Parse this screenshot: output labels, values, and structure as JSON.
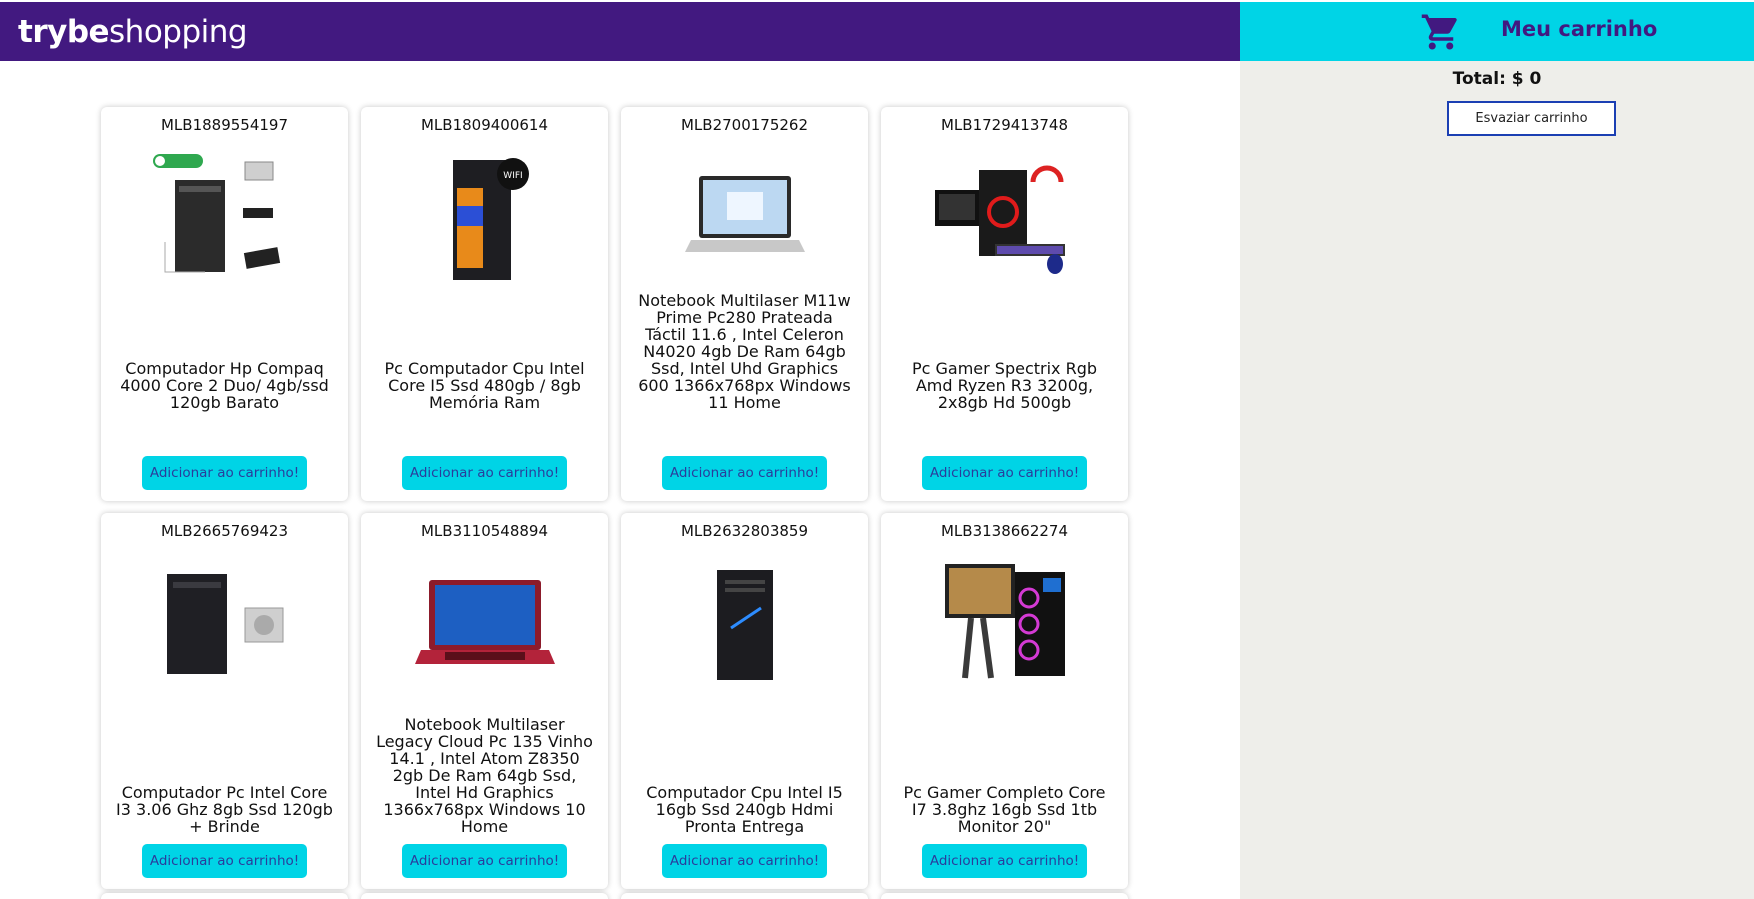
{
  "brand": {
    "bold": "trybe",
    "light": "shopping"
  },
  "cart": {
    "icon": "shopping-cart-icon",
    "title": "Meu carrinho",
    "total": "Total: $ 0",
    "empty_label": "Esvaziar carrinho"
  },
  "colors": {
    "header": "#421980",
    "accent": "#00d4e6",
    "panel": "#eeeeea",
    "button_border": "#1b3fb3"
  },
  "products": [
    {
      "id": "MLB1889554197",
      "title": "Computador Hp Compaq 4000 Core 2 Duo/ 4gb/ssd 120gb Barato",
      "button": "Adicionar ao carrinho!",
      "image": "desktop-tower-with-accessories"
    },
    {
      "id": "MLB1809400614",
      "title": "Pc Computador Cpu Intel Core I5 Ssd 480gb / 8gb Memória Ram",
      "button": "Adicionar ao carrinho!",
      "image": "black-pc-tower-wifi"
    },
    {
      "id": "MLB2700175262",
      "title": "Notebook Multilaser M11w Prime Pc280 Prateada Táctil 11.6 , Intel Celeron N4020 4gb De Ram 64gb Ssd, Intel Uhd Graphics 600 1366x768px Windows 11 Home",
      "button": "Adicionar ao carrinho!",
      "image": "silver-laptop"
    },
    {
      "id": "MLB1729413748",
      "title": "Pc Gamer Spectrix Rgb Amd Ryzen R3 3200g, 2x8gb Hd 500gb",
      "button": "Adicionar ao carrinho!",
      "image": "gamer-pc-kit"
    },
    {
      "id": "MLB2665769423",
      "title": "Computador Pc Intel Core I3 3.06 Ghz 8gb Ssd 120gb + Brinde",
      "button": "Adicionar ao carrinho!",
      "image": "pc-tower-with-psu"
    },
    {
      "id": "MLB3110548894",
      "title": "Notebook Multilaser Legacy Cloud Pc 135 Vinho 14.1 , Intel Atom Z8350 2gb De Ram 64gb Ssd, Intel Hd Graphics 1366x768px Windows 10 Home",
      "button": "Adicionar ao carrinho!",
      "image": "red-laptop"
    },
    {
      "id": "MLB2632803859",
      "title": "Computador Cpu Intel I5 16gb Ssd 240gb Hdmi Pronta Entrega",
      "button": "Adicionar ao carrinho!",
      "image": "black-pc-tower"
    },
    {
      "id": "MLB3138662274",
      "title": "Pc Gamer Completo Core I7 3.8ghz 16gb Ssd 1tb Monitor 20\"",
      "button": "Adicionar ao carrinho!",
      "image": "gamer-pc-complete"
    }
  ]
}
